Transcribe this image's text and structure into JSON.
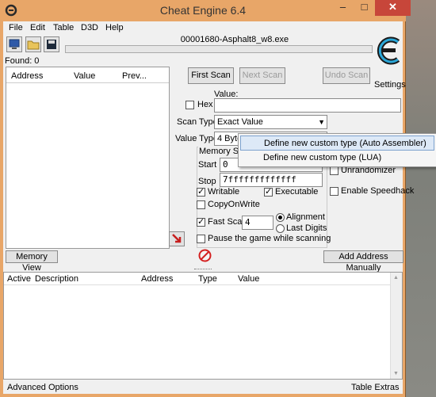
{
  "window": {
    "title": "Cheat Engine 6.4",
    "controls": {
      "minimize": "–",
      "maximize": "□",
      "close": "✕"
    }
  },
  "menu": [
    "File",
    "Edit",
    "Table",
    "D3D",
    "Help"
  ],
  "process": {
    "title": "00001680-Asphalt8_w8.exe"
  },
  "found": "Found: 0",
  "results": {
    "columns": [
      "Address",
      "Value",
      "Prev..."
    ]
  },
  "scan": {
    "first_scan": "First Scan",
    "next_scan": "Next Scan",
    "undo_scan": "Undo Scan",
    "value_label": "Value:",
    "hex_label": "Hex",
    "value_input": "",
    "scan_type_label": "Scan Type",
    "scan_type_value": "Exact Value",
    "value_type_label": "Value Type",
    "value_type_value": "4 Bytes",
    "memory_scan_label": "Memory Scan",
    "start_label": "Start",
    "start_value": "0",
    "stop_label": "Stop",
    "stop_value": "7fffffffffffff",
    "writable": "Writable",
    "executable": "Executable",
    "copyonwrite": "CopyOnWrite",
    "fast_scan": "Fast Scan",
    "fast_scan_value": "4",
    "alignment": "Alignment",
    "last_digits": "Last Digits",
    "pause_game": "Pause the game while scanning",
    "unrandomizer": "Unrandomizer",
    "enable_speedhack": "Enable Speedhack"
  },
  "settings_label": "Settings",
  "popup": {
    "items": [
      "Define new custom type (Auto Assembler)",
      "Define new custom type (LUA)"
    ]
  },
  "buttons": {
    "memory_view": "Memory View",
    "add_address": "Add Address Manually"
  },
  "table": {
    "columns": [
      "Active",
      "Description",
      "Address",
      "Type",
      "Value"
    ]
  },
  "footer": {
    "advanced": "Advanced Options",
    "extras": "Table Extras"
  }
}
